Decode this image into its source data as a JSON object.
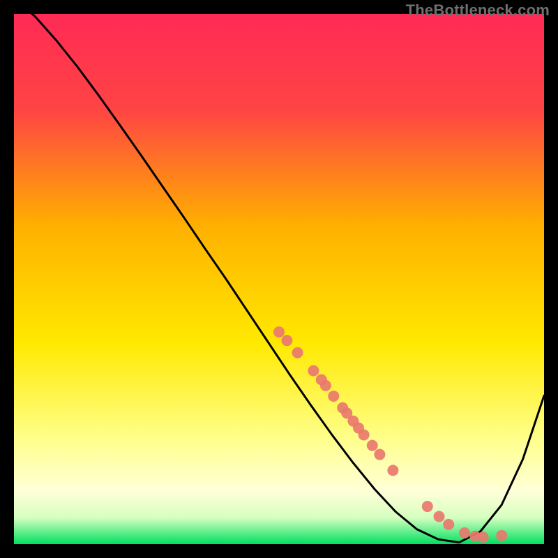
{
  "watermark": "TheBottleneck.com",
  "chart_data": {
    "type": "line",
    "title": "",
    "xlabel": "",
    "ylabel": "",
    "xlim": [
      0,
      100
    ],
    "ylim": [
      0,
      100
    ],
    "grid": false,
    "legend": false,
    "gradient_stops": [
      {
        "offset": 0.0,
        "color": "#ff2a55"
      },
      {
        "offset": 0.18,
        "color": "#ff4444"
      },
      {
        "offset": 0.4,
        "color": "#ffb000"
      },
      {
        "offset": 0.62,
        "color": "#ffe900"
      },
      {
        "offset": 0.8,
        "color": "#ffff8a"
      },
      {
        "offset": 0.9,
        "color": "#ffffd8"
      },
      {
        "offset": 0.95,
        "color": "#d6ffbf"
      },
      {
        "offset": 1.0,
        "color": "#00e060"
      }
    ],
    "series": [
      {
        "name": "curve",
        "x": [
          0,
          4,
          8,
          12,
          16,
          20,
          24,
          28,
          32,
          36,
          40,
          44,
          48,
          52,
          56,
          60,
          64,
          68,
          72,
          76,
          80,
          84,
          88,
          92,
          96,
          100
        ],
        "y": [
          103,
          99.5,
          95,
          90,
          84.6,
          79,
          73.3,
          67.5,
          61.7,
          55.8,
          50,
          44,
          38,
          32,
          26.2,
          20.6,
          15.3,
          10.4,
          6.1,
          2.8,
          0.9,
          0.3,
          2.4,
          7.4,
          16.0,
          28.0
        ]
      }
    ],
    "scatter_points": {
      "name": "markers",
      "color": "#e9786e",
      "radius": 8,
      "x": [
        50,
        51.5,
        53.5,
        56.5,
        58,
        58.8,
        60.3,
        62,
        62.8,
        64,
        65,
        66,
        67.6,
        69,
        71.5,
        78,
        80.2,
        82,
        85,
        87,
        88.5,
        92
      ],
      "y": [
        40.0,
        38.4,
        36.1,
        32.7,
        31.0,
        29.9,
        27.9,
        25.7,
        24.7,
        23.2,
        21.9,
        20.6,
        18.6,
        16.9,
        13.9,
        7.1,
        5.2,
        3.7,
        2.1,
        1.5,
        1.3,
        1.6
      ]
    }
  }
}
